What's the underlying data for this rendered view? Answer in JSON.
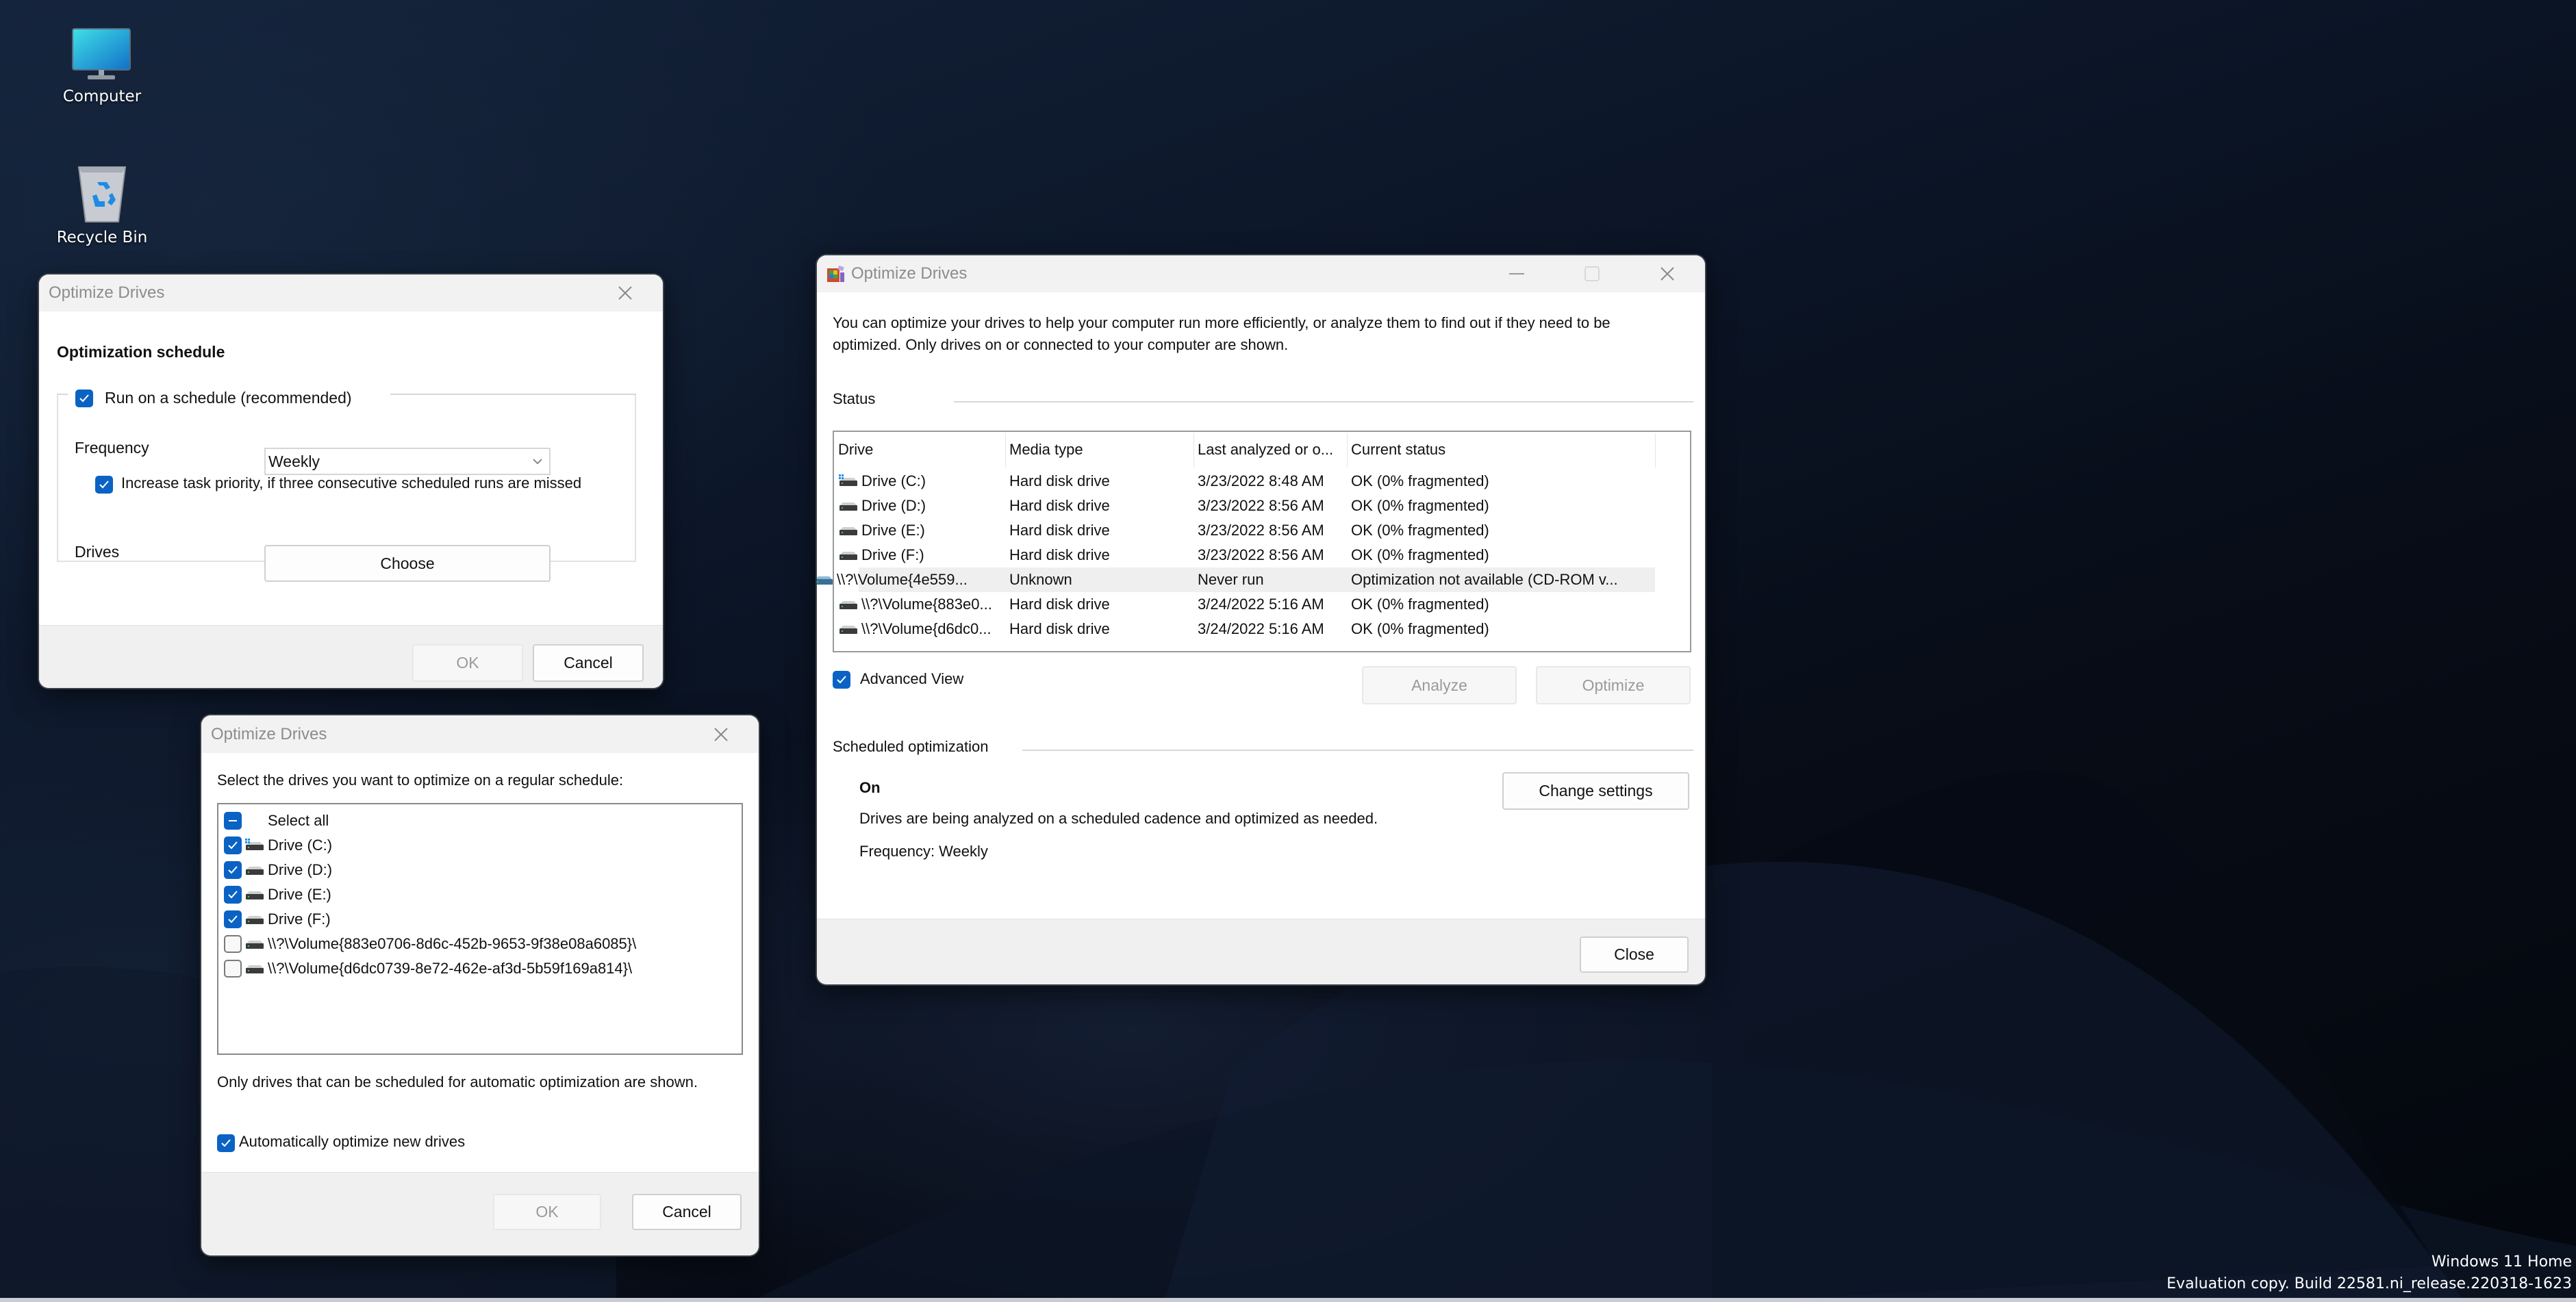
{
  "desktop": {
    "icons": [
      {
        "label": "Computer",
        "icon": "monitor-icon"
      },
      {
        "label": "Recycle Bin",
        "icon": "recycle-bin-icon"
      }
    ],
    "watermark": {
      "line1": "Windows 11 Home",
      "line2": "Evaluation copy. Build 22581.ni_release.220318-1623"
    }
  },
  "schedule_dialog": {
    "title": "Optimize Drives",
    "heading": "Optimization schedule",
    "run_on_schedule": {
      "label": "Run on a schedule (recommended)",
      "checked": true
    },
    "frequency": {
      "label": "Frequency",
      "value": "Weekly"
    },
    "increase_priority": {
      "label": "Increase task priority, if three consecutive scheduled runs are missed",
      "checked": true
    },
    "drives": {
      "label": "Drives",
      "button": "Choose"
    },
    "ok": "OK",
    "cancel": "Cancel"
  },
  "choose_dialog": {
    "title": "Optimize Drives",
    "instruction": "Select the drives you want to optimize on a regular schedule:",
    "items": [
      {
        "label": "Select all",
        "state": "indeterminate",
        "icon": "none"
      },
      {
        "label": "Drive (C:)",
        "state": "checked",
        "icon": "system-drive-icon"
      },
      {
        "label": "Drive (D:)",
        "state": "checked",
        "icon": "hard-drive-icon"
      },
      {
        "label": "Drive (E:)",
        "state": "checked",
        "icon": "hard-drive-icon"
      },
      {
        "label": "Drive (F:)",
        "state": "checked",
        "icon": "hard-drive-icon"
      },
      {
        "label": "\\\\?\\Volume{883e0706-8d6c-452b-9653-9f38e08a6085}\\",
        "state": "unchecked",
        "icon": "hard-drive-icon"
      },
      {
        "label": "\\\\?\\Volume{d6dc0739-8e72-462e-af3d-5b59f169a814}\\",
        "state": "unchecked",
        "icon": "hard-drive-icon"
      }
    ],
    "note": "Only drives that can be scheduled for automatic optimization are shown.",
    "auto_optimize": {
      "label": "Automatically optimize new drives",
      "checked": true
    },
    "ok": "OK",
    "cancel": "Cancel"
  },
  "main_window": {
    "title": "Optimize Drives",
    "description": "You can optimize your drives to help your computer run more efficiently, or analyze them to find out if they need to be optimized. Only drives on or connected to your computer are shown.",
    "status_label": "Status",
    "columns": [
      "Drive",
      "Media type",
      "Last analyzed or o...",
      "Current status"
    ],
    "rows": [
      {
        "drive": "Drive (C:)",
        "media": "Hard disk drive",
        "last": "3/23/2022 8:48 AM",
        "status": "OK (0% fragmented)",
        "icon": "system-drive-icon",
        "selected": false
      },
      {
        "drive": "Drive (D:)",
        "media": "Hard disk drive",
        "last": "3/23/2022 8:56 AM",
        "status": "OK (0% fragmented)",
        "icon": "hard-drive-icon",
        "selected": false
      },
      {
        "drive": "Drive (E:)",
        "media": "Hard disk drive",
        "last": "3/23/2022 8:56 AM",
        "status": "OK (0% fragmented)",
        "icon": "hard-drive-icon",
        "selected": false
      },
      {
        "drive": "Drive (F:)",
        "media": "Hard disk drive",
        "last": "3/23/2022 8:56 AM",
        "status": "OK (0% fragmented)",
        "icon": "hard-drive-icon",
        "selected": false
      },
      {
        "drive": "\\\\?\\Volume{4e559...",
        "media": "Unknown",
        "last": "Never run",
        "status": "Optimization not available (CD-ROM v...",
        "icon": "cdrom-drive-icon",
        "selected": true
      },
      {
        "drive": "\\\\?\\Volume{883e0...",
        "media": "Hard disk drive",
        "last": "3/24/2022 5:16 AM",
        "status": "OK (0% fragmented)",
        "icon": "hard-drive-icon",
        "selected": false
      },
      {
        "drive": "\\\\?\\Volume{d6dc0...",
        "media": "Hard disk drive",
        "last": "3/24/2022 5:16 AM",
        "status": "OK (0% fragmented)",
        "icon": "hard-drive-icon",
        "selected": false
      }
    ],
    "advanced_view": {
      "label": "Advanced View",
      "checked": true
    },
    "analyze": "Analyze",
    "optimize": "Optimize",
    "scheduled_label": "Scheduled optimization",
    "schedule_state": "On",
    "schedule_desc": "Drives are being analyzed on a scheduled cadence and optimized as needed.",
    "schedule_freq": "Frequency: Weekly",
    "change_settings": "Change settings",
    "close": "Close"
  },
  "colors": {
    "accent": "#0a63c4",
    "title_text": "#8c8c8c",
    "selected_row": "#efefef"
  }
}
